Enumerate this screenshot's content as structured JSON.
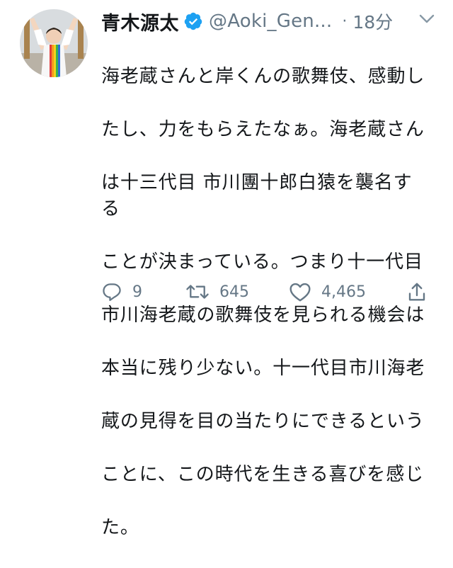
{
  "tweet": {
    "display_name": "青木源太",
    "handle": "@Aoki_Gen...",
    "separator": "·",
    "timestamp": "18分",
    "text": "海老蔵さんと岸くんの歌舞伎、感動したし、力をもらえたなぁ。海老蔵さんは十三代目 市川團十郎白猿を襲名することが決まっている。つまり十一代目市川海老蔵の歌舞伎を見られる機会は本当に残り少ない。十一代目市川海老蔵の見得を目の当たりにできるということに、この時代を生きる喜びを感じた。",
    "text_lines": [
      "海老蔵さんと岸くんの歌舞伎、感動し",
      "たし、力をもらえたなぁ。海老蔵さん",
      "は十三代目 市川團十郎白猿を襲名する",
      "ことが決まっている。つまり十一代目",
      "市川海老蔵の歌舞伎を見られる機会は",
      "本当に残り少ない。十一代目市川海老",
      "蔵の見得を目の当たりにできるという",
      "ことに、この時代を生きる喜びを感じ",
      "た。"
    ],
    "verified": true
  },
  "actions": {
    "reply_count": "9",
    "retweet_count": "645",
    "like_count": "4,465"
  },
  "icons": {
    "verified": "verified-badge-icon",
    "more": "chevron-down-icon",
    "reply": "reply-icon",
    "retweet": "retweet-icon",
    "like": "heart-icon",
    "share": "share-icon"
  },
  "colors": {
    "text_primary": "#14171a",
    "text_secondary": "#657786",
    "verified_blue": "#1da1f2"
  }
}
